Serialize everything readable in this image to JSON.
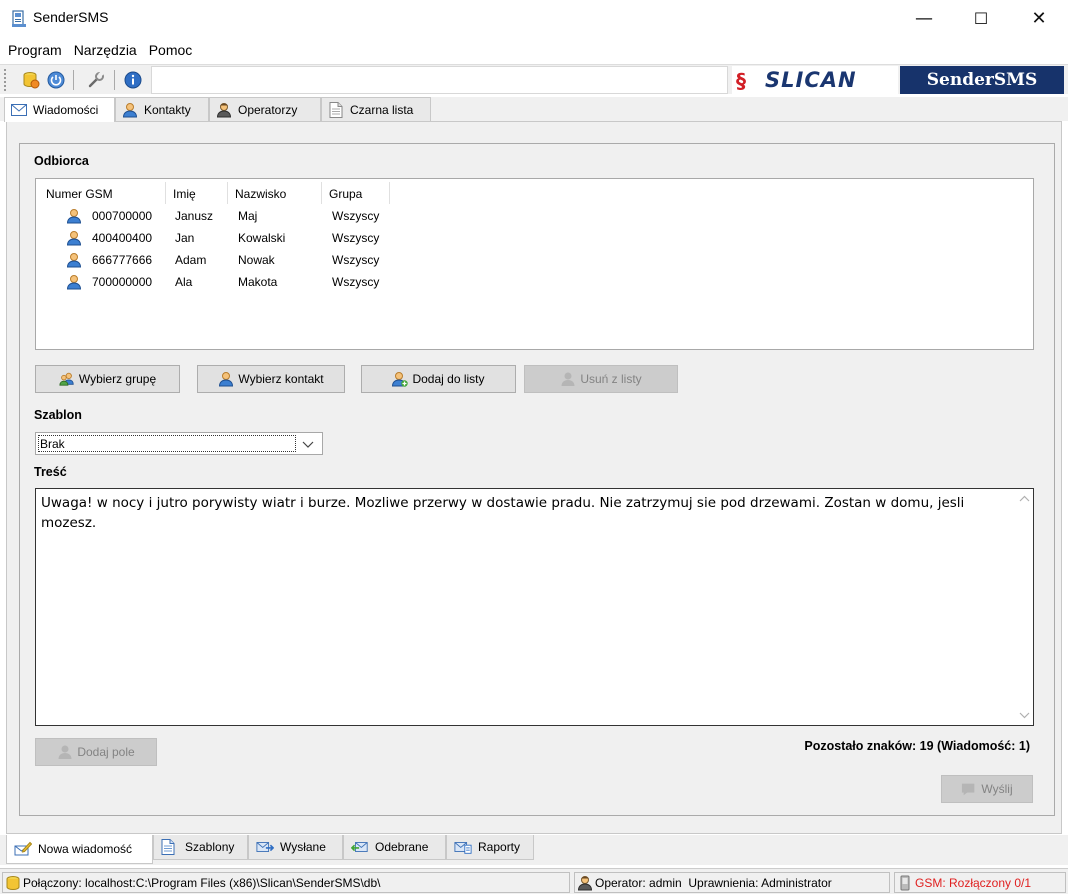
{
  "window": {
    "title": "SenderSMS",
    "minimize": "—",
    "maximize": "☐",
    "close": "✕"
  },
  "menu": [
    "Program",
    "Narzędzia",
    "Pomoc"
  ],
  "toolbar": {
    "logo_brand": "SLICAN",
    "logo_product": "SenderSMS"
  },
  "top_tabs": [
    {
      "label": "Wiadomości",
      "icon": "envelope-icon"
    },
    {
      "label": "Kontakty",
      "icon": "person-icon"
    },
    {
      "label": "Operatorzy",
      "icon": "operator-icon"
    },
    {
      "label": "Czarna lista",
      "icon": "document-icon"
    }
  ],
  "recipient": {
    "label": "Odbiorca",
    "columns": [
      "Numer GSM",
      "Imię",
      "Nazwisko",
      "Grupa"
    ],
    "rows": [
      [
        "000700000",
        "Janusz",
        "Maj",
        "Wszyscy"
      ],
      [
        "400400400",
        "Jan",
        "Kowalski",
        "Wszyscy"
      ],
      [
        "666777666",
        "Adam",
        "Nowak",
        "Wszyscy"
      ],
      [
        "700000000",
        "Ala",
        "Makota",
        "Wszyscy"
      ]
    ]
  },
  "buttons": {
    "select_group": "Wybierz grupę",
    "select_contact": "Wybierz kontakt",
    "add_to_list": "Dodaj do listy",
    "remove_from_list": "Usuń z listy",
    "add_field": "Dodaj pole",
    "send": "Wyślij"
  },
  "template": {
    "label": "Szablon",
    "selected": "Brak"
  },
  "content": {
    "label": "Treść",
    "text": "Uwaga! w nocy i jutro porywisty wiatr i burze. Mozliwe przerwy w dostawie pradu. Nie zatrzymuj sie pod drzewami. Zostan w domu, jesli mozesz."
  },
  "remaining": "Pozostało znaków: 19 (Wiadomość: 1)",
  "bottom_tabs": [
    {
      "label": "Nowa wiadomość",
      "icon": "new-message-icon"
    },
    {
      "label": "Szablony",
      "icon": "document-icon"
    },
    {
      "label": "Wysłane",
      "icon": "sent-icon"
    },
    {
      "label": "Odebrane",
      "icon": "received-icon"
    },
    {
      "label": "Raporty",
      "icon": "reports-icon"
    }
  ],
  "status": {
    "connection": "Połączony: localhost:C:\\Program Files (x86)\\Slican\\SenderSMS\\db\\",
    "operator": "Operator: admin  Uprawnienia: Administrator",
    "gsm": "GSM: Rozłączony 0/1"
  },
  "colors": {
    "brand_navy": "#17336b",
    "brand_red": "#d21f26",
    "gsm_status": "#e02020"
  }
}
